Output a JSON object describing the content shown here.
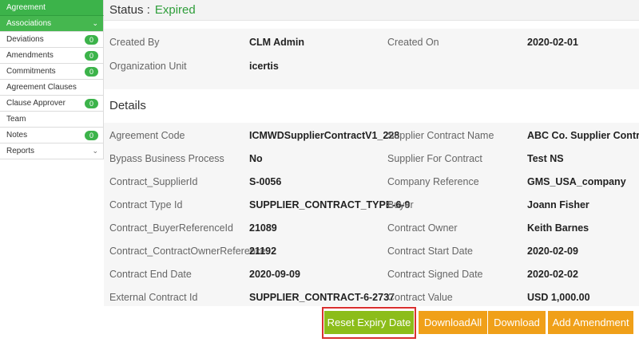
{
  "sidebar": {
    "items": [
      {
        "label": "Agreement",
        "badge": null,
        "chevron": false,
        "style": "green"
      },
      {
        "label": "Associations",
        "badge": null,
        "chevron": true,
        "style": "green2"
      },
      {
        "label": "Deviations",
        "badge": "0",
        "chevron": false,
        "style": ""
      },
      {
        "label": "Amendments",
        "badge": "0",
        "chevron": false,
        "style": ""
      },
      {
        "label": "Commitments",
        "badge": "0",
        "chevron": false,
        "style": ""
      },
      {
        "label": "Agreement Clauses",
        "badge": null,
        "chevron": false,
        "style": ""
      },
      {
        "label": "Clause Approver",
        "badge": "0",
        "chevron": false,
        "style": ""
      },
      {
        "label": "Team",
        "badge": null,
        "chevron": false,
        "style": ""
      },
      {
        "label": "Notes",
        "badge": "0",
        "chevron": false,
        "style": ""
      },
      {
        "label": "Reports",
        "badge": null,
        "chevron": true,
        "style": ""
      }
    ]
  },
  "status": {
    "label": "Status :",
    "value": "Expired"
  },
  "summary": [
    {
      "l1": "Created By",
      "v1": "CLM Admin",
      "l2": "Created On",
      "v2": "2020-02-01"
    },
    {
      "l1": "Organization Unit",
      "v1": "icertis",
      "l2": "",
      "v2": ""
    }
  ],
  "details_title": "Details",
  "details": [
    {
      "l1": "Agreement Code",
      "v1": "ICMWDSupplierContractV1_228",
      "l2": "Supplier Contract Name",
      "v2": "ABC Co. Supplier Contract"
    },
    {
      "l1": "Bypass Business Process",
      "v1": "No",
      "l2": "Supplier For Contract",
      "v2": "Test NS"
    },
    {
      "l1": "Contract_SupplierId",
      "v1": "S-0056",
      "l2": "Company Reference",
      "v2": "GMS_USA_company"
    },
    {
      "l1": "Contract Type Id",
      "v1": "SUPPLIER_CONTRACT_TYPE-6-9",
      "l2": "Buyer",
      "v2": "Joann Fisher"
    },
    {
      "l1": "Contract_BuyerReferenceId",
      "v1": "21089",
      "l2": "Contract Owner",
      "v2": "Keith Barnes"
    },
    {
      "l1": "Contract_ContractOwnerReference",
      "v1": "21192",
      "l2": "Contract Start Date",
      "v2": "2020-02-09"
    },
    {
      "l1": "Contract End Date",
      "v1": "2020-09-09",
      "l2": "Contract Signed Date",
      "v2": "2020-02-02"
    },
    {
      "l1": "External Contract Id",
      "v1": "SUPPLIER_CONTRACT-6-2737",
      "l2": "Contract Value",
      "v2": "USD 1,000.00"
    }
  ],
  "actions": {
    "reset": "Reset Expiry Date",
    "download_all": "DownloadAll",
    "download": "Download",
    "add_amendment": "Add Amendment"
  },
  "colors": {
    "green": "#3cb34a",
    "orange": "#f0a019",
    "reset_green": "#8cbd1a",
    "highlight": "#d93030"
  }
}
